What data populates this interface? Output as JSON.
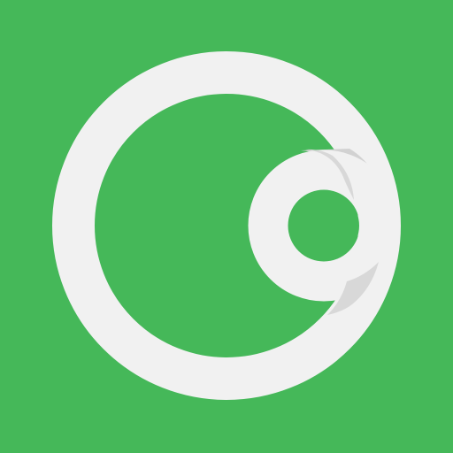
{
  "app_icon": {
    "icon": "ring-with-inner-loop-logo-icon",
    "colors": {
      "background": "#45B859",
      "ring": "#F1F1F1",
      "ring_shadow": "#D2D2D2"
    }
  }
}
